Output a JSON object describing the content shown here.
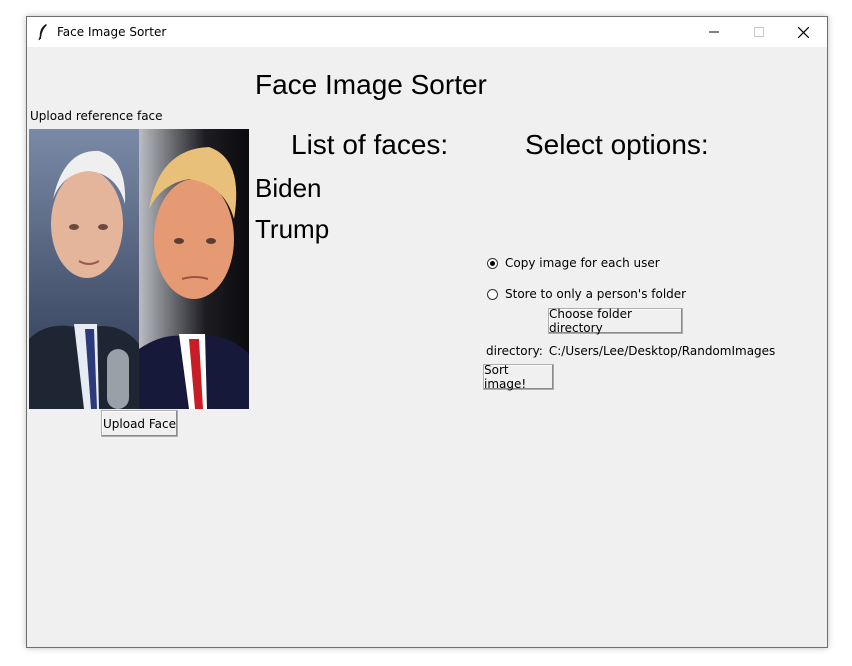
{
  "window": {
    "title": "Face Image Sorter"
  },
  "main": {
    "title": "Face Image Sorter",
    "upload_label": "Upload reference face",
    "upload_button": "Upload Face",
    "list_heading": "List of faces:",
    "faces": [
      "Biden",
      "Trump"
    ],
    "options_heading": "Select options:",
    "radio_options": [
      {
        "label": "Copy image for each user",
        "checked": true
      },
      {
        "label": "Store to only a person's folder",
        "checked": false
      }
    ],
    "choose_folder_button": "Choose folder directory",
    "directory_label": "directory:",
    "directory_value": "C:/Users/Lee/Desktop/RandomImages",
    "sort_button": "Sort image!"
  }
}
